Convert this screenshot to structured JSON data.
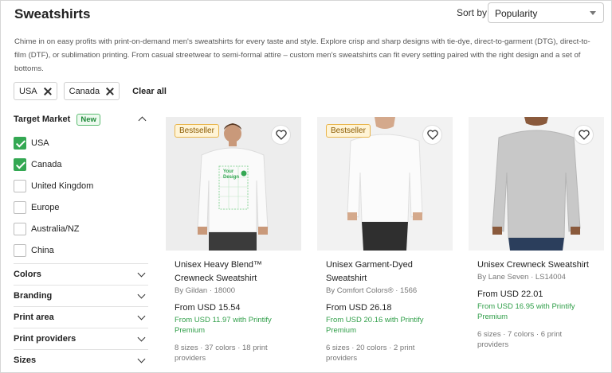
{
  "page": {
    "title": "Sweatshirts",
    "sort_label": "Sort by",
    "sort_value": "Popularity",
    "description": "Chime in on easy profits with print-on-demand men's sweatshirts for every taste and style. Explore crisp and sharp designs with tie-dye, direct-to-garment (DTG), direct-to-film (DTF), or sublimation printing. From casual streetwear to semi-formal attire – custom men's sweatshirts can fit every setting paired with the right design and a set of bottoms."
  },
  "filters": {
    "chips": [
      {
        "label": "USA"
      },
      {
        "label": "Canada"
      }
    ],
    "clear_all": "Clear all"
  },
  "sidebar": {
    "target_market": {
      "label": "Target Market",
      "badge": "New",
      "options": [
        {
          "label": "USA",
          "checked": true
        },
        {
          "label": "Canada",
          "checked": true
        },
        {
          "label": "United Kingdom",
          "checked": false
        },
        {
          "label": "Europe",
          "checked": false
        },
        {
          "label": "Australia/NZ",
          "checked": false
        },
        {
          "label": "China",
          "checked": false
        }
      ]
    },
    "sections": [
      {
        "label": "Colors"
      },
      {
        "label": "Branding"
      },
      {
        "label": "Print area"
      },
      {
        "label": "Print providers"
      },
      {
        "label": "Sizes"
      }
    ]
  },
  "products": [
    {
      "badge": "Bestseller",
      "name": "Unisex Heavy Blend™ Crewneck Sweatshirt",
      "brand": "By Gildan · 18000",
      "price": "From USD 15.54",
      "premium": "From USD 11.97 with Printify Premium",
      "meta": "8 sizes · 37 colors · 18 print providers",
      "design_text": "Your Design"
    },
    {
      "badge": "Bestseller",
      "name": "Unisex Garment-Dyed Sweatshirt",
      "brand": "By Comfort Colors® · 1566",
      "price": "From USD 26.18",
      "premium": "From USD 20.16 with Printify Premium",
      "meta": "6 sizes · 20 colors · 2 print providers"
    },
    {
      "badge": "",
      "name": "Unisex Crewneck Sweatshirt",
      "brand": "By Lane Seven · LS14004",
      "price": "From USD 22.01",
      "premium": "From USD 16.95 with Printify Premium",
      "meta": "6 sizes · 7 colors · 6 print providers"
    }
  ],
  "colors": {
    "accent": "#34a853",
    "premium_text": "#2f9e48",
    "bestseller_bg": "#fff4d6"
  }
}
